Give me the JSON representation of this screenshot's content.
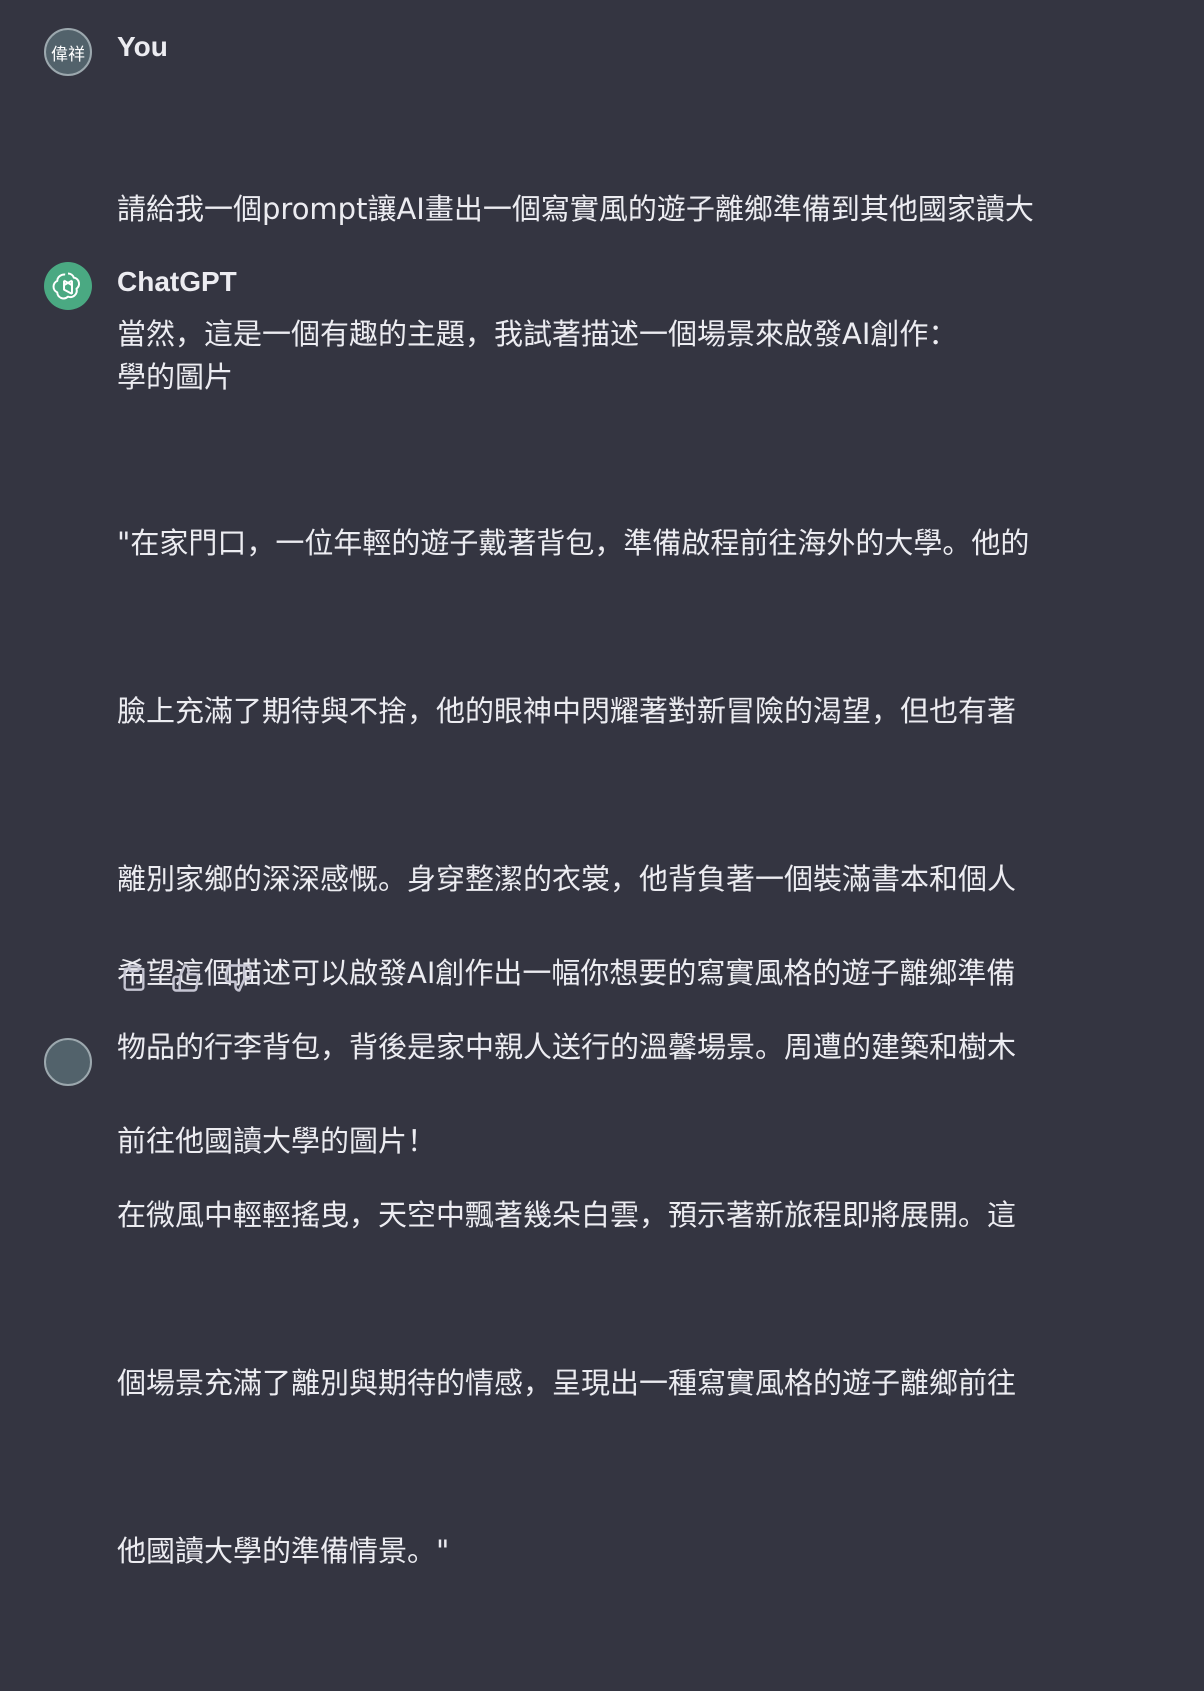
{
  "user_message": {
    "avatar_text": "偉祥",
    "sender": "You",
    "lines": [
      "請給我一個prompt讓AI畫出一個寫實風的遊子離鄉準備到其他國家讀大",
      "學的圖片"
    ]
  },
  "assistant_message": {
    "sender": "ChatGPT",
    "intro": "當然，這是一個有趣的主題，我試著描述一個場景來啟發AI創作：",
    "quote_lines": [
      "\"在家門口，一位年輕的遊子戴著背包，準備啟程前往海外的大學。他的",
      "臉上充滿了期待與不捨，他的眼神中閃耀著對新冒險的渴望，但也有著",
      "離別家鄉的深深感慨。身穿整潔的衣裳，他背負著一個裝滿書本和個人",
      "物品的行李背包，背後是家中親人送行的溫馨場景。周遭的建築和樹木",
      "在微風中輕輕搖曳，天空中飄著幾朵白雲，預示著新旅程即將展開。這",
      "個場景充滿了離別與期待的情感，呈現出一種寫實風格的遊子離鄉前往",
      "他國讀大學的準備情景。\""
    ],
    "closing_lines": [
      "希望這個描述可以啟發AI創作出一幅你想要的寫實風格的遊子離鄉準備",
      "前往他國讀大學的圖片！"
    ]
  },
  "actions": [
    {
      "icon": "clipboard-icon"
    },
    {
      "icon": "thumbs-up-icon"
    },
    {
      "icon": "thumbs-down-icon"
    }
  ],
  "colors": {
    "background": "#343541",
    "text": "#ececf1",
    "gpt_avatar": "#4aa982",
    "user_avatar": "#52626b"
  }
}
